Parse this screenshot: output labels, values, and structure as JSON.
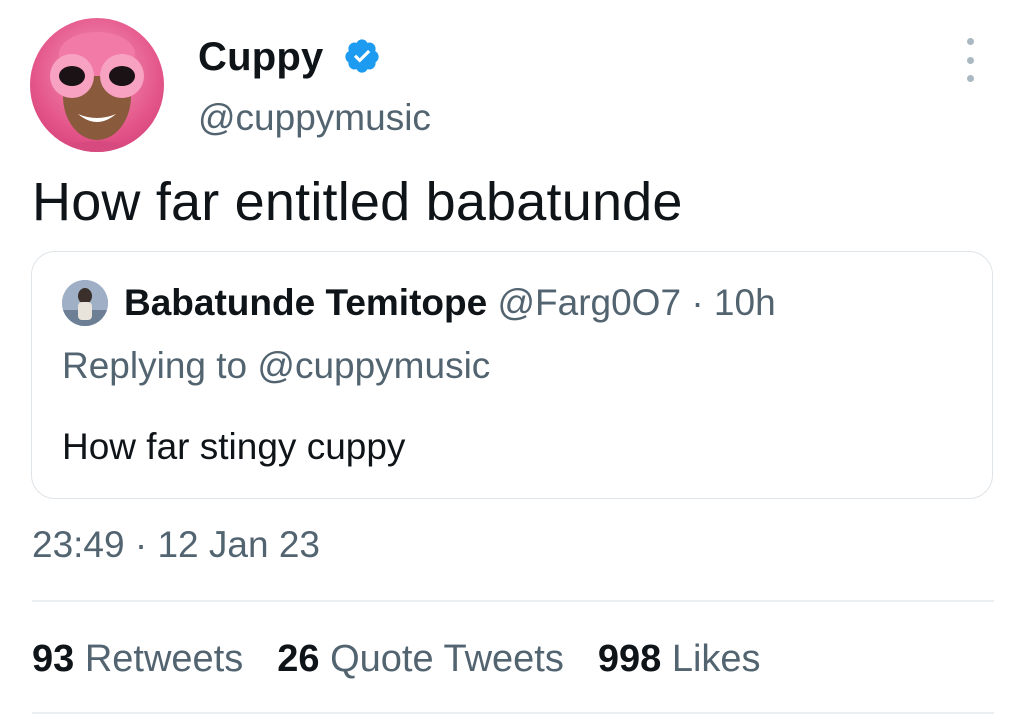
{
  "tweet": {
    "author": {
      "name": "Cuppy",
      "handle": "@cuppymusic",
      "verified": true,
      "avatar_icon": "profile-photo"
    },
    "text": "How far entitled babatunde",
    "menu_icon": "more-options-icon",
    "quoted_tweet": {
      "author_name": "Babatunde Temitope",
      "author_handle": "@Farg0O7",
      "separator": "·",
      "time_ago": "10h",
      "replying_to_label": "Replying to",
      "replying_to_handle": "@cuppymusic",
      "text": "How far stingy cuppy"
    },
    "time": "23:49",
    "separator": "·",
    "date": "12 Jan 23",
    "stats": {
      "retweets_count": "93",
      "retweets_label": "Retweets",
      "quote_tweets_count": "26",
      "quote_tweets_label": "Quote Tweets",
      "likes_count": "998",
      "likes_label": "Likes"
    }
  },
  "colors": {
    "text_primary": "#0f1419",
    "text_secondary": "#536471",
    "verified_blue": "#1d9bf0",
    "border": "#dfe4e8",
    "avatar_pink": "#e4568a"
  }
}
